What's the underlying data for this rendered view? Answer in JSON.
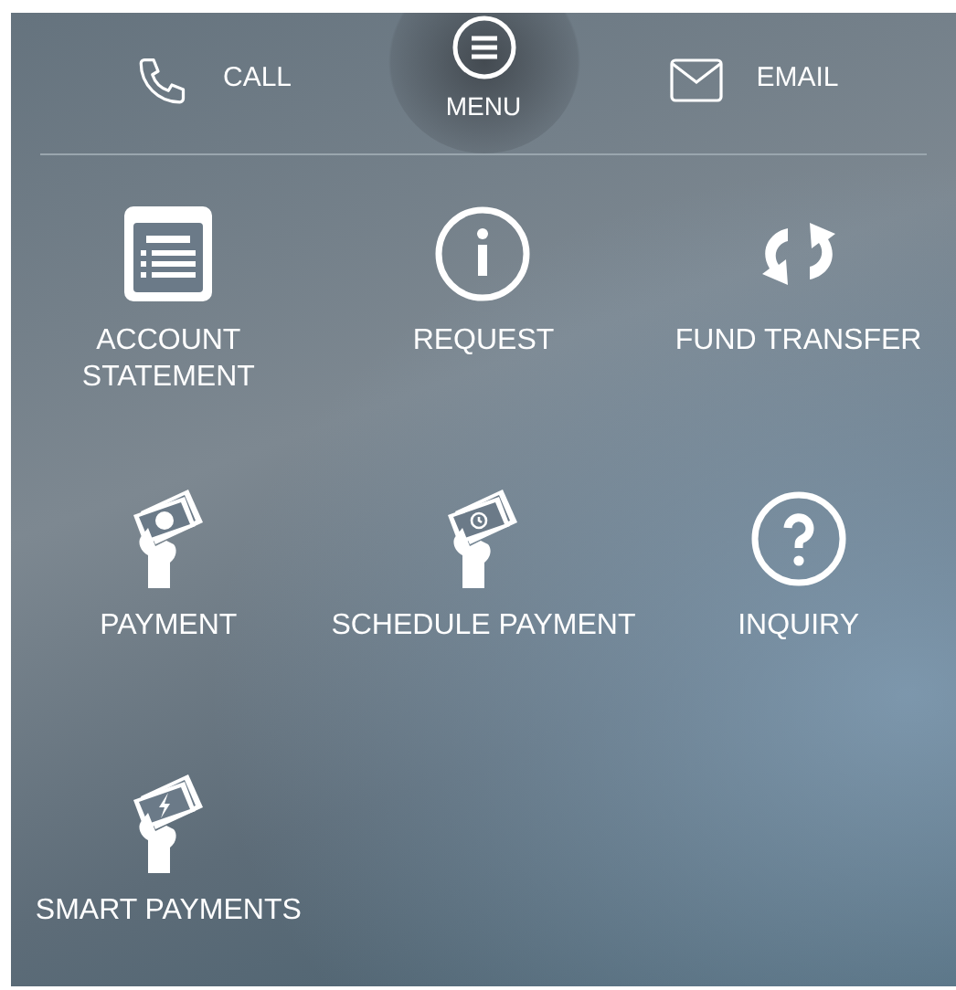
{
  "top_bar": {
    "items": [
      {
        "kind": "call",
        "label": "CALL"
      },
      {
        "kind": "menu",
        "label": "MENU"
      },
      {
        "kind": "email",
        "label": "EMAIL"
      }
    ]
  },
  "menu_items": [
    {
      "kind": "statement",
      "label": "ACCOUNT STATEMENT"
    },
    {
      "kind": "info",
      "label": "REQUEST"
    },
    {
      "kind": "transfer",
      "label": "FUND TRANSFER"
    },
    {
      "kind": "cash",
      "label": "PAYMENT"
    },
    {
      "kind": "schedule",
      "label": "SCHEDULE PAYMENT"
    },
    {
      "kind": "question",
      "label": "INQUIRY"
    },
    {
      "kind": "smart",
      "label": "SMART PAYMENTS"
    }
  ]
}
